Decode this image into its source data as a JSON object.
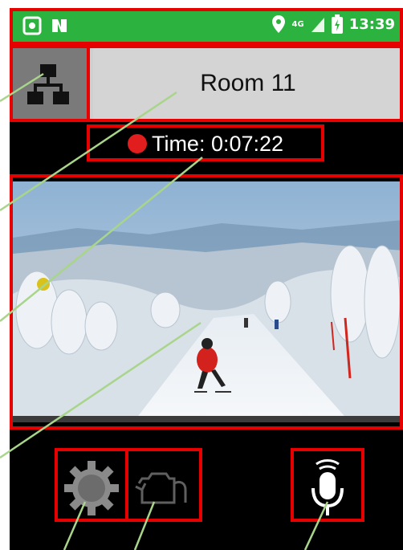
{
  "status_bar": {
    "time": "13:39",
    "network_label": "4G",
    "icons": [
      "app-badge-icon",
      "nfc-icon",
      "location-icon",
      "signal-icon",
      "battery-charging-icon"
    ]
  },
  "header": {
    "network_button_icon": "network-topology-icon",
    "room_name": "Room 11"
  },
  "timer": {
    "recording": true,
    "text": "Time: 0:07:22"
  },
  "video": {
    "scene": "ski-slope-camera-feed"
  },
  "controls": {
    "settings_icon": "gear-icon",
    "camera_switch_icon": "camera-switch-icon",
    "microphone_icon": "microphone-icon"
  },
  "colors": {
    "status_bar": "#2cb33f",
    "highlight": "#e60000",
    "recording": "#e11d1d"
  }
}
